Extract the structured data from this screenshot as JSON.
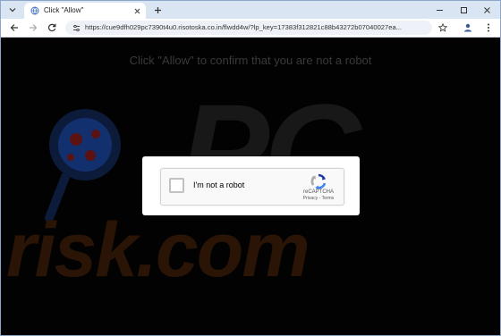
{
  "browser": {
    "tab": {
      "title": "Click \"Allow\""
    },
    "omnibox": {
      "url": "https://cue9dfh029pc7390t4u0.risotoska.co.in/flwdd4w/?lp_key=17383f312821c88b43272b07040027ea..."
    }
  },
  "page": {
    "headline": "Click \"Allow\" to confirm that you are not a robot",
    "captcha": {
      "checkbox_label": "I'm not a robot",
      "brand": "reCAPTCHA",
      "privacy_link": "Privacy",
      "separator": " - ",
      "terms_link": "Terms"
    },
    "watermark": {
      "pc_text": "PC",
      "risk_text": "risk.com"
    }
  },
  "colors": {
    "page_background": "#020202",
    "tab_strip": "#dae5f3",
    "headline_text": "#3a3a3a",
    "watermark_orange": "#2a1406"
  },
  "icons": {
    "tab_menu": "chevron-down-icon",
    "favicon": "globe-icon",
    "tab_close": "close-icon",
    "new_tab": "plus-icon",
    "minimize": "minimize-icon",
    "maximize": "maximize-icon",
    "close_window": "close-icon",
    "back": "arrow-left-icon",
    "forward": "arrow-right-icon",
    "reload": "reload-icon",
    "site_info": "tune-icon",
    "bookmark": "star-icon",
    "profile": "person-icon",
    "menu": "kebab-menu-icon"
  }
}
